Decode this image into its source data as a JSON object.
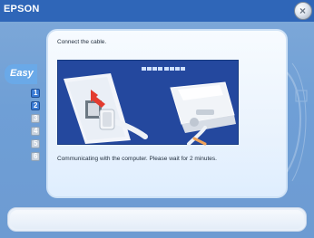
{
  "app": {
    "title": "EPSON"
  },
  "left_rail": {
    "easy_label": "Easy",
    "steps": [
      {
        "label": "1",
        "active": true
      },
      {
        "label": "2",
        "active": true
      },
      {
        "label": "3",
        "active": false
      },
      {
        "label": "4",
        "active": false
      },
      {
        "label": "5",
        "active": false
      },
      {
        "label": "6",
        "active": false
      }
    ]
  },
  "main": {
    "instruction": "Connect the cable.",
    "wait_message": "Communicating with the computer. Please wait for 2 minutes."
  },
  "colors": {
    "topbar": "#2f66b8",
    "illustration_bg": "#24489e",
    "accent_arrow": "#e33b2f"
  }
}
